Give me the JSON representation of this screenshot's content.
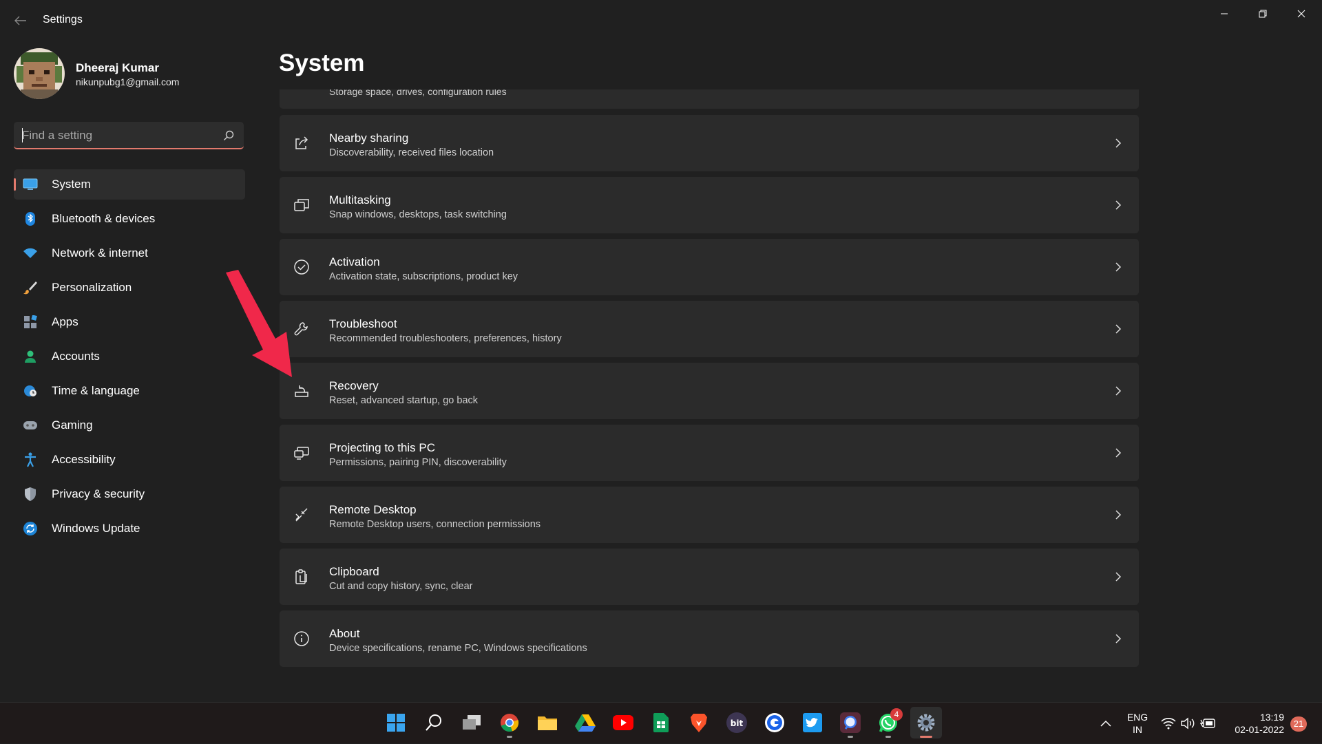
{
  "app": {
    "title": "Settings"
  },
  "user": {
    "name": "Dheeraj Kumar",
    "email": "nikunpubg1@gmail.com"
  },
  "search": {
    "placeholder": "Find a setting"
  },
  "sidebar": {
    "items": [
      {
        "label": "System",
        "icon": "monitor-icon",
        "active": true
      },
      {
        "label": "Bluetooth & devices",
        "icon": "bluetooth-icon"
      },
      {
        "label": "Network & internet",
        "icon": "wifi-icon"
      },
      {
        "label": "Personalization",
        "icon": "brush-icon"
      },
      {
        "label": "Apps",
        "icon": "apps-icon"
      },
      {
        "label": "Accounts",
        "icon": "person-icon"
      },
      {
        "label": "Time & language",
        "icon": "globe-clock-icon"
      },
      {
        "label": "Gaming",
        "icon": "gamepad-icon"
      },
      {
        "label": "Accessibility",
        "icon": "accessibility-icon"
      },
      {
        "label": "Privacy & security",
        "icon": "shield-icon"
      },
      {
        "label": "Windows Update",
        "icon": "update-icon"
      }
    ]
  },
  "main": {
    "title": "System",
    "partial_item": {
      "subtitle": "Storage space, drives, configuration rules"
    },
    "items": [
      {
        "title": "Nearby sharing",
        "subtitle": "Discoverability, received files location",
        "icon": "share-icon"
      },
      {
        "title": "Multitasking",
        "subtitle": "Snap windows, desktops, task switching",
        "icon": "multitasking-icon"
      },
      {
        "title": "Activation",
        "subtitle": "Activation state, subscriptions, product key",
        "icon": "check-circle-icon"
      },
      {
        "title": "Troubleshoot",
        "subtitle": "Recommended troubleshooters, preferences, history",
        "icon": "wrench-icon"
      },
      {
        "title": "Recovery",
        "subtitle": "Reset, advanced startup, go back",
        "icon": "recovery-icon"
      },
      {
        "title": "Projecting to this PC",
        "subtitle": "Permissions, pairing PIN, discoverability",
        "icon": "projecting-icon"
      },
      {
        "title": "Remote Desktop",
        "subtitle": "Remote Desktop users, connection permissions",
        "icon": "remote-desktop-icon"
      },
      {
        "title": "Clipboard",
        "subtitle": "Cut and copy history, sync, clear",
        "icon": "clipboard-icon"
      },
      {
        "title": "About",
        "subtitle": "Device specifications, rename PC, Windows specifications",
        "icon": "info-icon"
      }
    ]
  },
  "taskbar": {
    "apps": [
      "start-icon",
      "search-icon",
      "task-view-icon",
      "chrome-icon",
      "file-explorer-icon",
      "google-drive-icon",
      "youtube-icon",
      "google-sheets-icon",
      "brave-icon",
      "bit-icon",
      "app-c-icon",
      "twitter-icon",
      "chat-icon",
      "whatsapp-icon",
      "settings-icon"
    ],
    "whatsapp_badge": "4",
    "bit_label": "bit",
    "language": {
      "line1": "ENG",
      "line2": "IN"
    },
    "time": "13:19",
    "date": "02-01-2022",
    "notifications": "21"
  },
  "colors": {
    "accent": "#e27a6d",
    "background": "#202020",
    "card": "#2b2b2b",
    "annotation_arrow": "#f0284a"
  }
}
